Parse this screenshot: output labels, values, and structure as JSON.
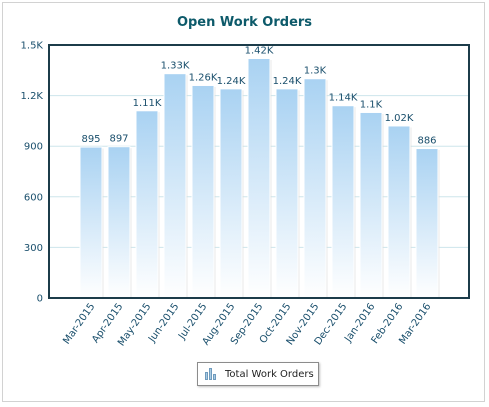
{
  "chart_data": {
    "type": "bar",
    "title": "Open Work Orders",
    "categories": [
      "Mar-2015",
      "Apr-2015",
      "May-2015",
      "Jun-2015",
      "Jul-2015",
      "Aug-2015",
      "Sep-2015",
      "Oct-2015",
      "Nov-2015",
      "Dec-2015",
      "Jan-2016",
      "Feb-2016",
      "Mar-2016"
    ],
    "series": [
      {
        "name": "Total Work Orders",
        "values": [
          895,
          897,
          1110,
          1330,
          1260,
          1240,
          1420,
          1240,
          1300,
          1140,
          1100,
          1020,
          886
        ],
        "value_labels": [
          "895",
          "897",
          "1.11K",
          "1.33K",
          "1.26K",
          "1.24K",
          "1.42K",
          "1.24K",
          "1.3K",
          "1.14K",
          "1.1K",
          "1.02K",
          "886"
        ]
      }
    ],
    "ylim": [
      0,
      1500
    ],
    "yticks": [
      0,
      300,
      600,
      900,
      1200,
      1500
    ],
    "ytick_labels": [
      "0",
      "300",
      "600",
      "900",
      "1.2K",
      "1.5K"
    ],
    "xlabel": "",
    "ylabel": "",
    "grid": true,
    "legend_position": "bottom-center",
    "colors": {
      "bar_top": "#a9d2f2",
      "bar_bottom": "#ffffff",
      "plot_border": "#1c3c4a",
      "grid": "#cde5ec",
      "title": "#0d5a6a",
      "axis_text": "#1a4f6c"
    }
  },
  "legend": {
    "label": "Total Work Orders",
    "icon": "bar-chart-icon"
  }
}
